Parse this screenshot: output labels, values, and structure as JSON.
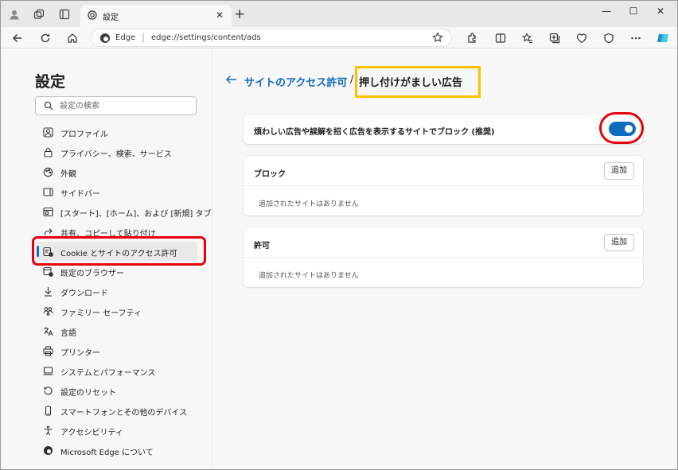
{
  "tab": {
    "title": "設定",
    "close": "✕"
  },
  "window": {
    "minimize": "—",
    "maximize": "☐",
    "close": "✕",
    "new_tab": "+"
  },
  "address": {
    "brand": "Edge",
    "separator": "|",
    "url": "edge://settings/content/ads"
  },
  "sidebar": {
    "title": "設定",
    "search_placeholder": "設定の検索",
    "items": [
      {
        "label": "プロファイル",
        "icon": "profile-icon"
      },
      {
        "label": "プライバシー、検索、サービス",
        "icon": "lock-icon"
      },
      {
        "label": "外観",
        "icon": "appearance-icon"
      },
      {
        "label": "サイドバー",
        "icon": "sidebar-icon"
      },
      {
        "label": "[スタート]、[ホーム]、および [新規] タブ",
        "icon": "home-tab-icon"
      },
      {
        "label": "共有、コピーして貼り付け",
        "icon": "share-icon"
      },
      {
        "label": "Cookie とサイトのアクセス許可",
        "icon": "cookie-icon",
        "active": true
      },
      {
        "label": "既定のブラウザー",
        "icon": "default-browser-icon"
      },
      {
        "label": "ダウンロード",
        "icon": "download-icon"
      },
      {
        "label": "ファミリー セーフティ",
        "icon": "family-icon"
      },
      {
        "label": "言語",
        "icon": "language-icon"
      },
      {
        "label": "プリンター",
        "icon": "printer-icon"
      },
      {
        "label": "システムとパフォーマンス",
        "icon": "system-icon"
      },
      {
        "label": "設定のリセット",
        "icon": "reset-icon"
      },
      {
        "label": "スマートフォンとその他のデバイス",
        "icon": "phone-icon"
      },
      {
        "label": "アクセシビリティ",
        "icon": "accessibility-icon"
      },
      {
        "label": "Microsoft Edge について",
        "icon": "edge-icon"
      }
    ]
  },
  "main": {
    "breadcrumb_link": "サイトのアクセス許可",
    "breadcrumb_sep": "/",
    "breadcrumb_current": "押し付けがましい広告",
    "block_setting": {
      "label": "煩わしい広告や誤解を招く広告を表示するサイトでブロック (推奨)",
      "enabled": true
    },
    "block_card": {
      "title": "ブロック",
      "add": "追加",
      "empty": "追加されたサイトはありません"
    },
    "allow_card": {
      "title": "許可",
      "add": "追加",
      "empty": "追加されたサイトはありません"
    }
  },
  "colors": {
    "accent": "#0f6cbd",
    "annotation_red": "#e8000b",
    "annotation_yellow": "#ffc000"
  }
}
